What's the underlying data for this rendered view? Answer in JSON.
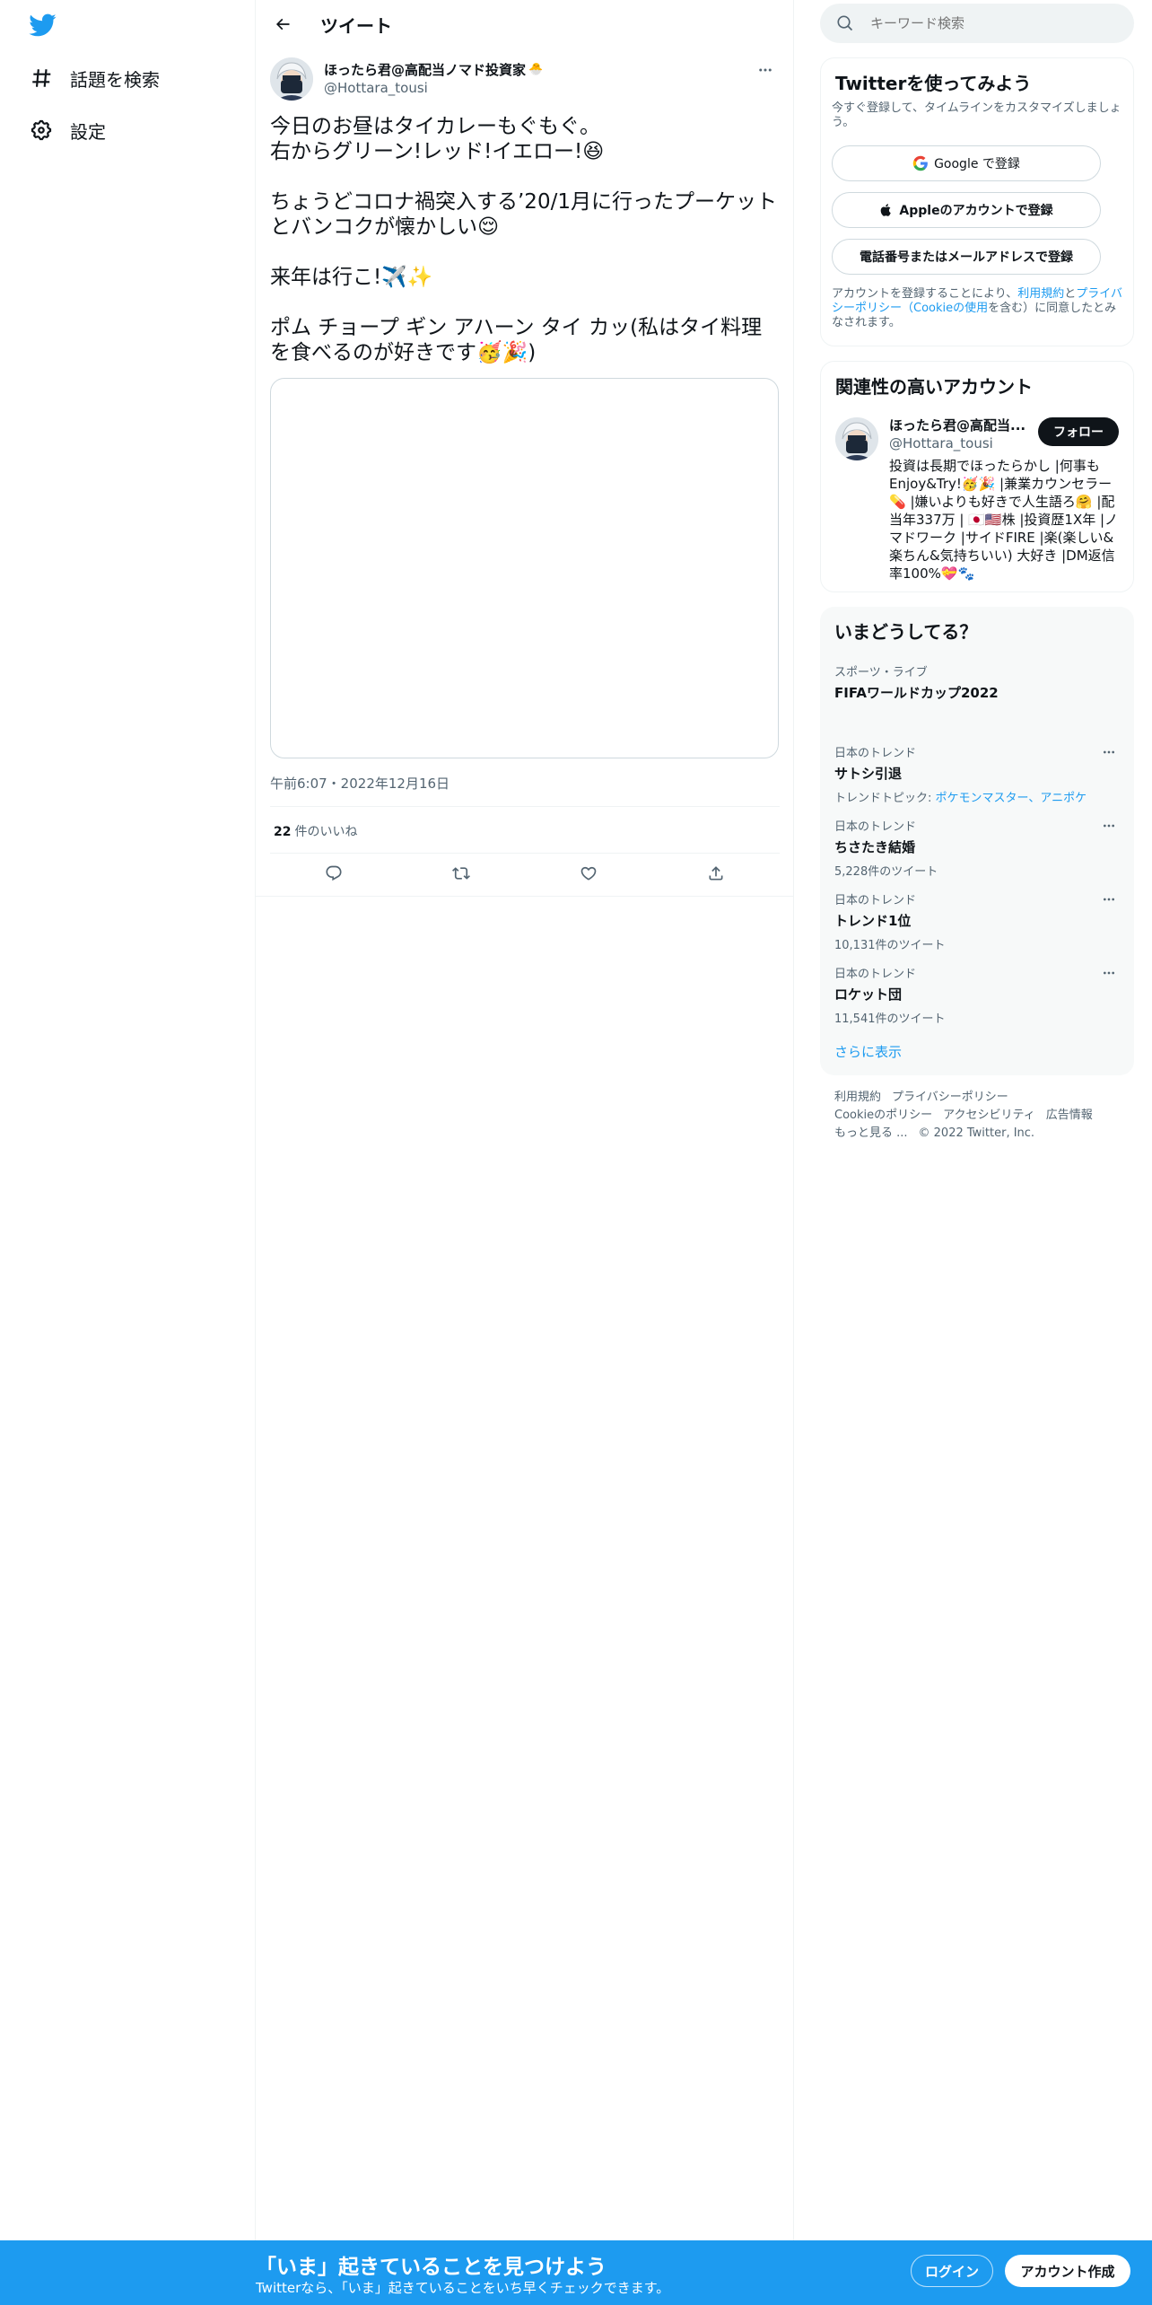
{
  "nav": {
    "items": [
      {
        "label": "話題を検索",
        "icon": "hashtag-icon"
      },
      {
        "label": "設定",
        "icon": "gear-icon"
      }
    ]
  },
  "header": {
    "title": "ツイート"
  },
  "tweet": {
    "author_name": "ほったら君@高配当ノマド投資家",
    "author_emoji": "🐣",
    "handle": "@Hottara_tousi",
    "lines": [
      "今日のお昼はタイカレーもぐもぐ。",
      "右からグリーン!レッド!イエロー!😆",
      "ちょうどコロナ禍突入する’20/1月に行ったプーケットとバンコクが懐かしい😌",
      "来年は行こ!✈️✨",
      "ポム チョープ ギン アハーン タイ カッ(私はタイ料理を食べるのが好きです🥳🎉)"
    ],
    "timestamp": "午前6:07・2022年12月16日",
    "likes_count": "22",
    "likes_label": "件のいいね"
  },
  "search": {
    "placeholder": "キーワード検索"
  },
  "signup_card": {
    "title": "Twitterを使ってみよう",
    "subtitle": "今すぐ登録して、タイムラインをカスタマイズしましょう。",
    "google_button": "Google で登録",
    "apple_button": "Appleのアカウントで登録",
    "phone_button": "電話番号またはメールアドレスで登録",
    "legal_prefix": "アカウントを登録することにより、",
    "legal_terms": "利用規約",
    "legal_and": "と",
    "legal_privacy": "プライバシーポリシー",
    "legal_cookie": "（Cookieの使用",
    "legal_suffix": "を含む）に同意したとみなされます。"
  },
  "related": {
    "title": "関連性の高いアカウント",
    "name": "ほったら君@高配当...",
    "handle": "@Hottara_tousi",
    "follow_label": "フォロー",
    "bio": "投資は長期でほったらかし |何事もEnjoy&Try!🥳🎉 |兼業カウンセラー💊 |嫌いよりも好きで人生語ろ🤗 |配当年337万 | 🇯🇵🇺🇸株 |投資歴1X年 |ノマドワーク |サイドFIRE |楽(楽しい&楽ちん&気持ちいい) 大好き |DM返信率100%💝🐾"
  },
  "trends": {
    "title": "いまどうしてる？",
    "items": [
      {
        "category": "スポーツ・ライブ",
        "title": "FIFAワールドカップ2022",
        "count": ""
      },
      {
        "category": "日本のトレンド",
        "title": "サトシ引退",
        "count": "",
        "topic_prefix": "トレンドトピック: ",
        "topic_links": "ポケモンマスター、アニポケ"
      },
      {
        "category": "日本のトレンド",
        "title": "ちさたき結婚",
        "count": "5,228件のツイート"
      },
      {
        "category": "日本のトレンド",
        "title": "トレンド1位",
        "count": "10,131件のツイート"
      },
      {
        "category": "日本のトレンド",
        "title": "ロケット団",
        "count": "11,541件のツイート"
      }
    ],
    "show_more": "さらに表示"
  },
  "footer": {
    "links": [
      "利用規約",
      "プライバシーポリシー",
      "Cookieのポリシー",
      "アクセシビリティ",
      "広告情報",
      "もっと見る ..."
    ],
    "copyright": "© 2022 Twitter, Inc."
  },
  "banner": {
    "title": "「いま」起きていることを見つけよう",
    "subtitle": "Twitterなら、「いま」起きていることをいち早くチェックできます。",
    "login": "ログイン",
    "signup": "アカウント作成"
  },
  "colors": {
    "accent": "#1d9bf0",
    "text": "#0f1419",
    "secondary": "#536471"
  }
}
